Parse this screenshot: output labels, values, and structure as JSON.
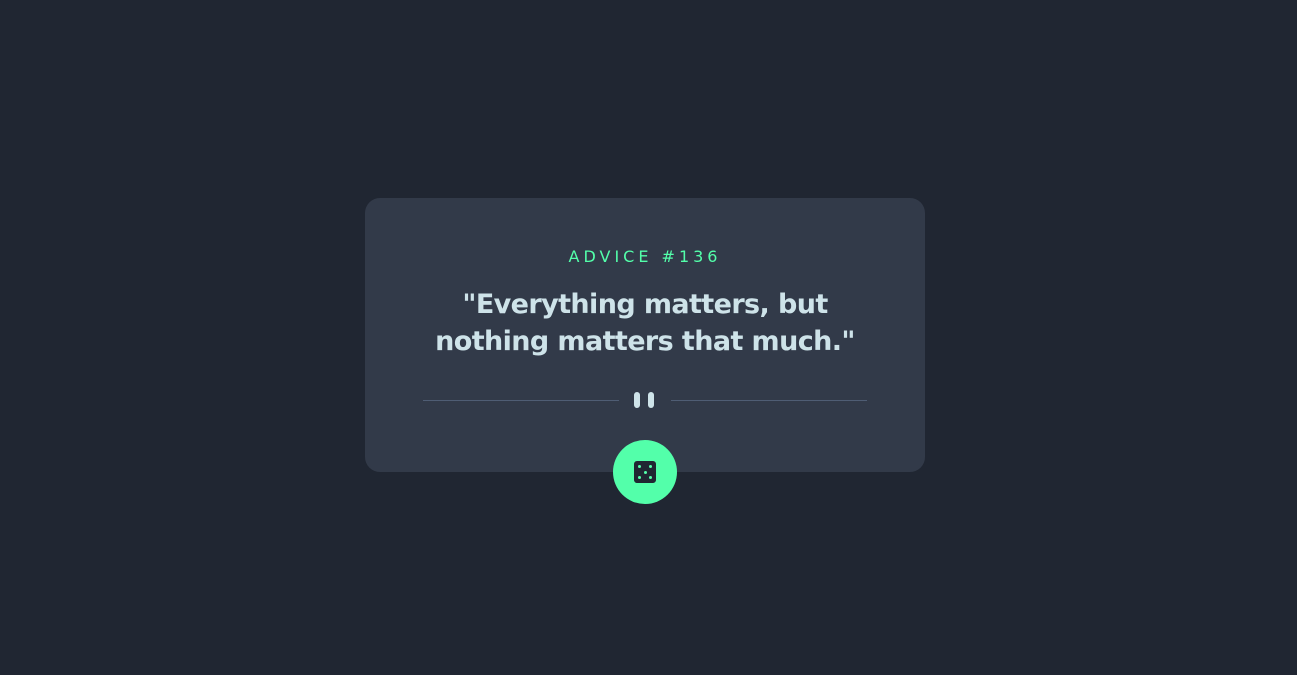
{
  "advice": {
    "id_label": "ADVICE #136",
    "text": "\"Everything matters, but nothing matters that much.\""
  },
  "divider": {
    "icon": "pause-icon"
  },
  "action": {
    "icon": "dice-icon"
  },
  "colors": {
    "background": "#202632",
    "card": "#323a49",
    "accent": "#53ffaa",
    "text": "#cee3e9",
    "divider": "#4f5d74"
  }
}
